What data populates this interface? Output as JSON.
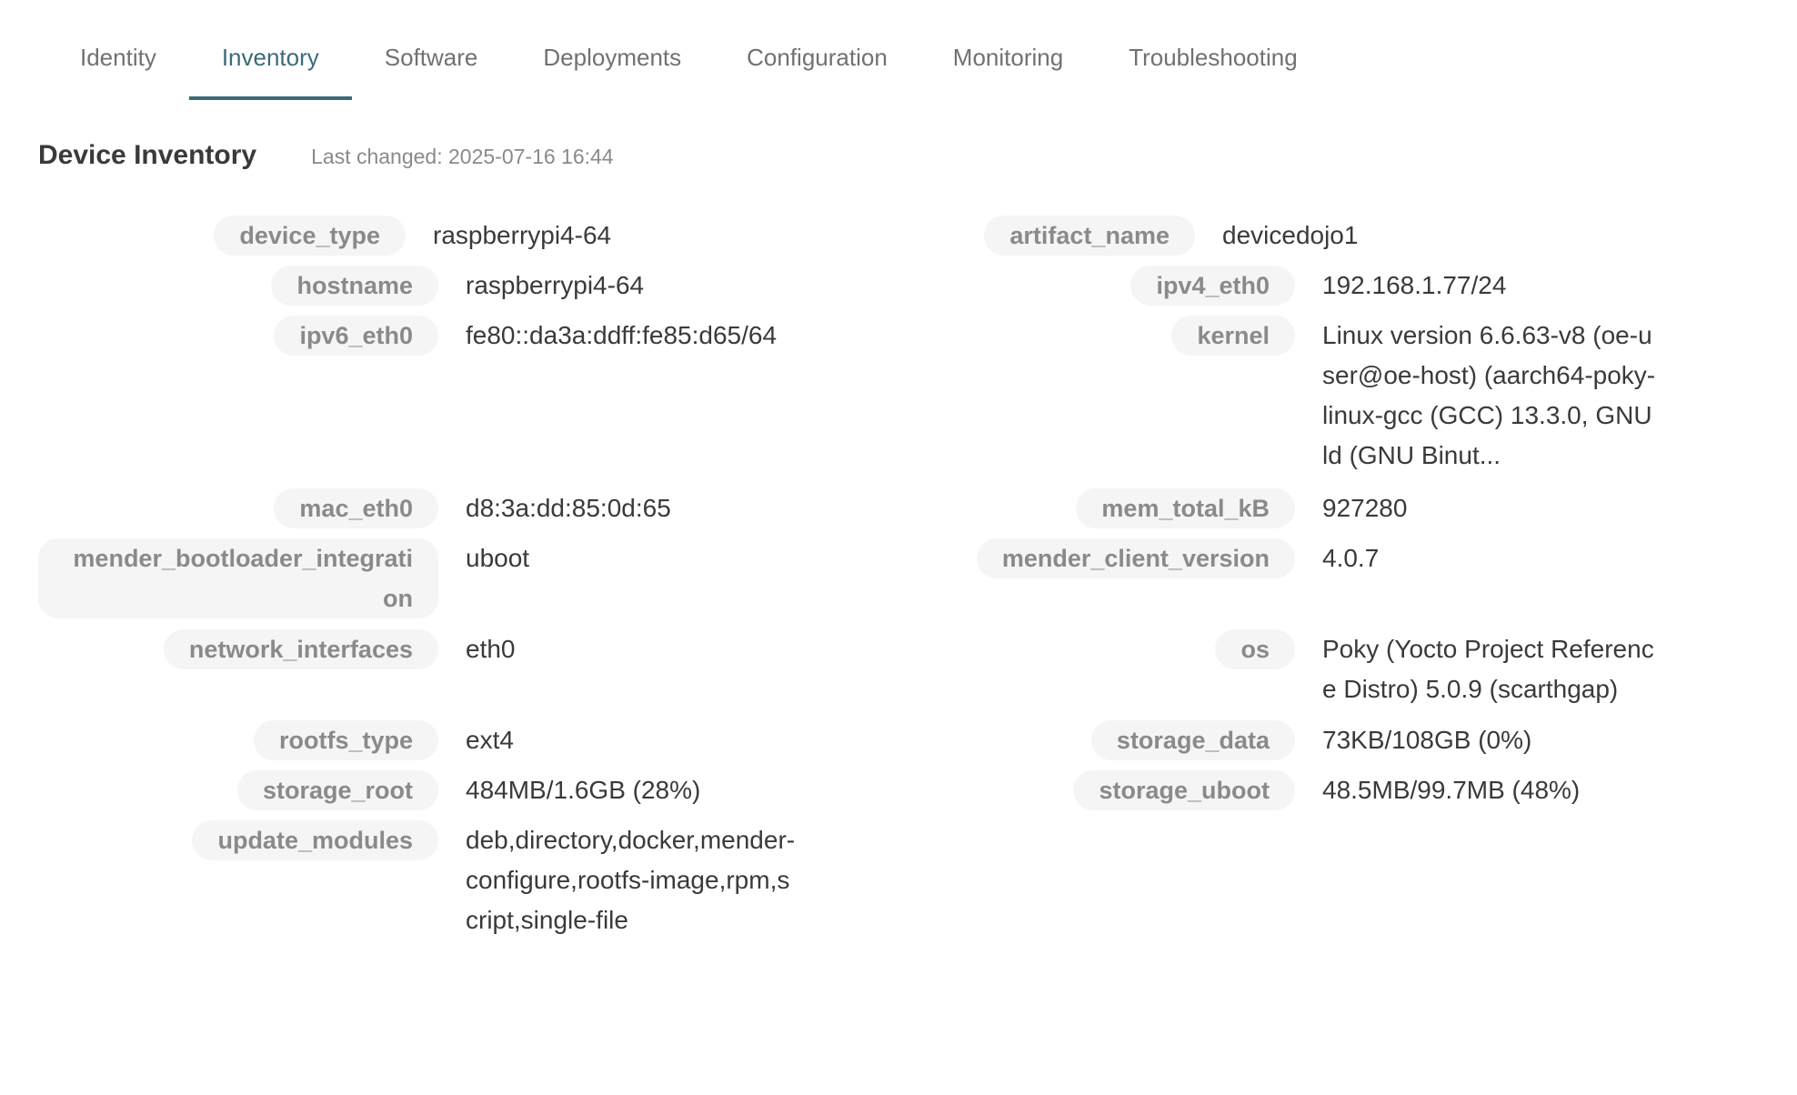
{
  "tabs": [
    {
      "label": "Identity"
    },
    {
      "label": "Inventory"
    },
    {
      "label": "Software"
    },
    {
      "label": "Deployments"
    },
    {
      "label": "Configuration"
    },
    {
      "label": "Monitoring"
    },
    {
      "label": "Troubleshooting"
    }
  ],
  "active_tab": "Inventory",
  "inventory": {
    "title": "Device Inventory",
    "last_changed": "Last changed: 2025-07-16 16:44",
    "left": [
      {
        "key": "device_type",
        "value": "raspberrypi4-64"
      },
      {
        "key": "hostname",
        "value": "raspberrypi4-64"
      },
      {
        "key": "ipv6_eth0",
        "value": "fe80::da3a:ddff:fe85:d65/64"
      },
      {
        "key": "mac_eth0",
        "value": "d8:3a:dd:85:0d:65"
      },
      {
        "key": "mender_bootloader_integration",
        "value": "uboot"
      },
      {
        "key": "network_interfaces",
        "value": "eth0"
      },
      {
        "key": "rootfs_type",
        "value": "ext4"
      },
      {
        "key": "storage_root",
        "value": "484MB/1.6GB (28%)"
      },
      {
        "key": "update_modules",
        "value": "deb,directory,docker,mender-configure,rootfs-image,rpm,script,single-file"
      }
    ],
    "right": [
      {
        "key": "artifact_name",
        "value": "devicedojo1"
      },
      {
        "key": "ipv4_eth0",
        "value": "192.168.1.77/24"
      },
      {
        "key": "kernel",
        "value": "Linux version 6.6.63-v8 (oe-user@oe-host) (aarch64-poky-linux-gcc (GCC) 13.3.0, GNU ld (GNU Binut..."
      },
      {
        "key": "mem_total_kB",
        "value": "927280"
      },
      {
        "key": "mender_client_version",
        "value": "4.0.7"
      },
      {
        "key": "os",
        "value": "Poky (Yocto Project Reference Distro) 5.0.9 (scarthgap)"
      },
      {
        "key": "storage_data",
        "value": "73KB/108GB (0%)"
      },
      {
        "key": "storage_uboot",
        "value": "48.5MB/99.7MB (48%)"
      }
    ]
  }
}
